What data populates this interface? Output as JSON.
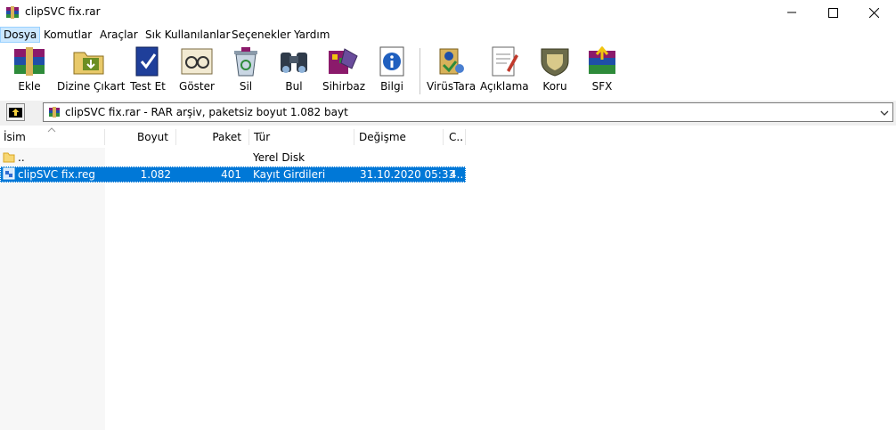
{
  "window": {
    "title": "clipSVC fix.rar"
  },
  "menu": [
    "Dosya",
    "Komutlar",
    "Araçlar",
    "Sık Kullanılanlar",
    "Seçenekler",
    "Yardım"
  ],
  "toolbar": {
    "ekle": "Ekle",
    "dizine_cikart": "Dizine Çıkart",
    "test_et": "Test Et",
    "goster": "Göster",
    "sil": "Sil",
    "bul": "Bul",
    "sihirbaz": "Sihirbaz",
    "bilgi": "Bilgi",
    "virustara": "VirüsTara",
    "aciklama": "Açıklama",
    "koru": "Koru",
    "sfx": "SFX"
  },
  "address": {
    "text": "clipSVC fix.rar - RAR arşiv, paketsiz boyut 1.082 bayt"
  },
  "columns": {
    "name": "İsim",
    "size": "Boyut",
    "packed": "Paket",
    "type": "Tür",
    "modified": "Değişme",
    "crc": "C.."
  },
  "files": [
    {
      "name": "..",
      "size": "",
      "packed": "",
      "type": "Yerel Disk",
      "modified": "",
      "crc": "",
      "selected": false
    },
    {
      "name": "clipSVC fix.reg",
      "size": "1.082",
      "packed": "401",
      "type": "Kayıt Girdileri",
      "modified": "31.10.2020 05:33",
      "crc": "4..",
      "selected": true
    }
  ],
  "colors": {
    "selection": "#0078d7",
    "menu_active": "#cce8ff"
  },
  "icons": [
    "winrar-icon",
    "minimize-icon",
    "maximize-icon",
    "close-icon",
    "up-folder-icon",
    "chevron-down-icon",
    "folder-icon",
    "reg-file-icon"
  ]
}
